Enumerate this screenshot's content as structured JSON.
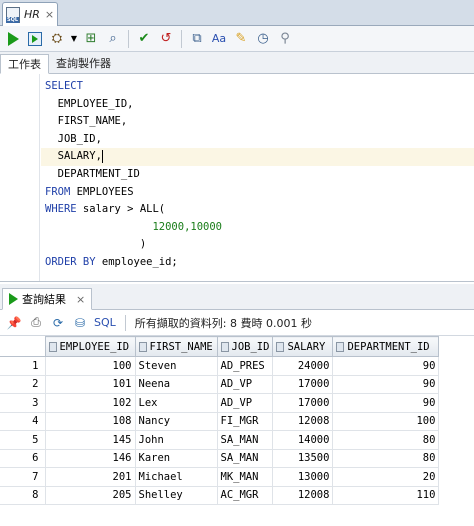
{
  "window": {
    "tab_label": "HR",
    "tab_close": "×"
  },
  "toolbar": {
    "icons": [
      "run-statement-icon",
      "run-script-icon",
      "explain-plan-icon",
      "autotrace-icon",
      "sql-tuning-icon",
      "commit-icon",
      "rollback-icon",
      "unshared-sql-icon",
      "format-icon",
      "clear-icon",
      "history-icon",
      "find-icon"
    ]
  },
  "subtabs": {
    "worksheet": "工作表",
    "query_builder": "查詢製作器"
  },
  "editor": {
    "lines": [
      {
        "kw": "SELECT",
        "text": ""
      },
      {
        "kw": "",
        "text": "  EMPLOYEE_ID,"
      },
      {
        "kw": "",
        "text": "  FIRST_NAME,"
      },
      {
        "kw": "",
        "text": "  JOB_ID,"
      },
      {
        "kw": "",
        "text": "  SALARY,"
      },
      {
        "kw": "",
        "text": "  DEPARTMENT_ID"
      },
      {
        "kw": "FROM",
        "text": " EMPLOYEES"
      },
      {
        "kw": "WHERE",
        "text": " salary > ALL("
      },
      {
        "kw": "",
        "text": "",
        "num": "                 12000,10000"
      },
      {
        "kw": "",
        "text": "               )"
      },
      {
        "kw": "ORDER BY",
        "text": " employee_id;"
      }
    ]
  },
  "results": {
    "tab_label": "查詢結果",
    "tab_close": "×",
    "sql_label": "SQL",
    "status": "所有擷取的資料列: 8 費時 0.001 秒",
    "columns": [
      "EMPLOYEE_ID",
      "FIRST_NAME",
      "JOB_ID",
      "SALARY",
      "DEPARTMENT_ID"
    ],
    "rows": [
      [
        "1",
        "100",
        "Steven",
        "AD_PRES",
        "24000",
        "90"
      ],
      [
        "2",
        "101",
        "Neena",
        "AD_VP",
        "17000",
        "90"
      ],
      [
        "3",
        "102",
        "Lex",
        "AD_VP",
        "17000",
        "90"
      ],
      [
        "4",
        "108",
        "Nancy",
        "FI_MGR",
        "12008",
        "100"
      ],
      [
        "5",
        "145",
        "John",
        "SA_MAN",
        "14000",
        "80"
      ],
      [
        "6",
        "146",
        "Karen",
        "SA_MAN",
        "13500",
        "80"
      ],
      [
        "7",
        "201",
        "Michael",
        "MK_MAN",
        "13000",
        "20"
      ],
      [
        "8",
        "205",
        "Shelley",
        "AC_MGR",
        "12008",
        "110"
      ]
    ]
  }
}
